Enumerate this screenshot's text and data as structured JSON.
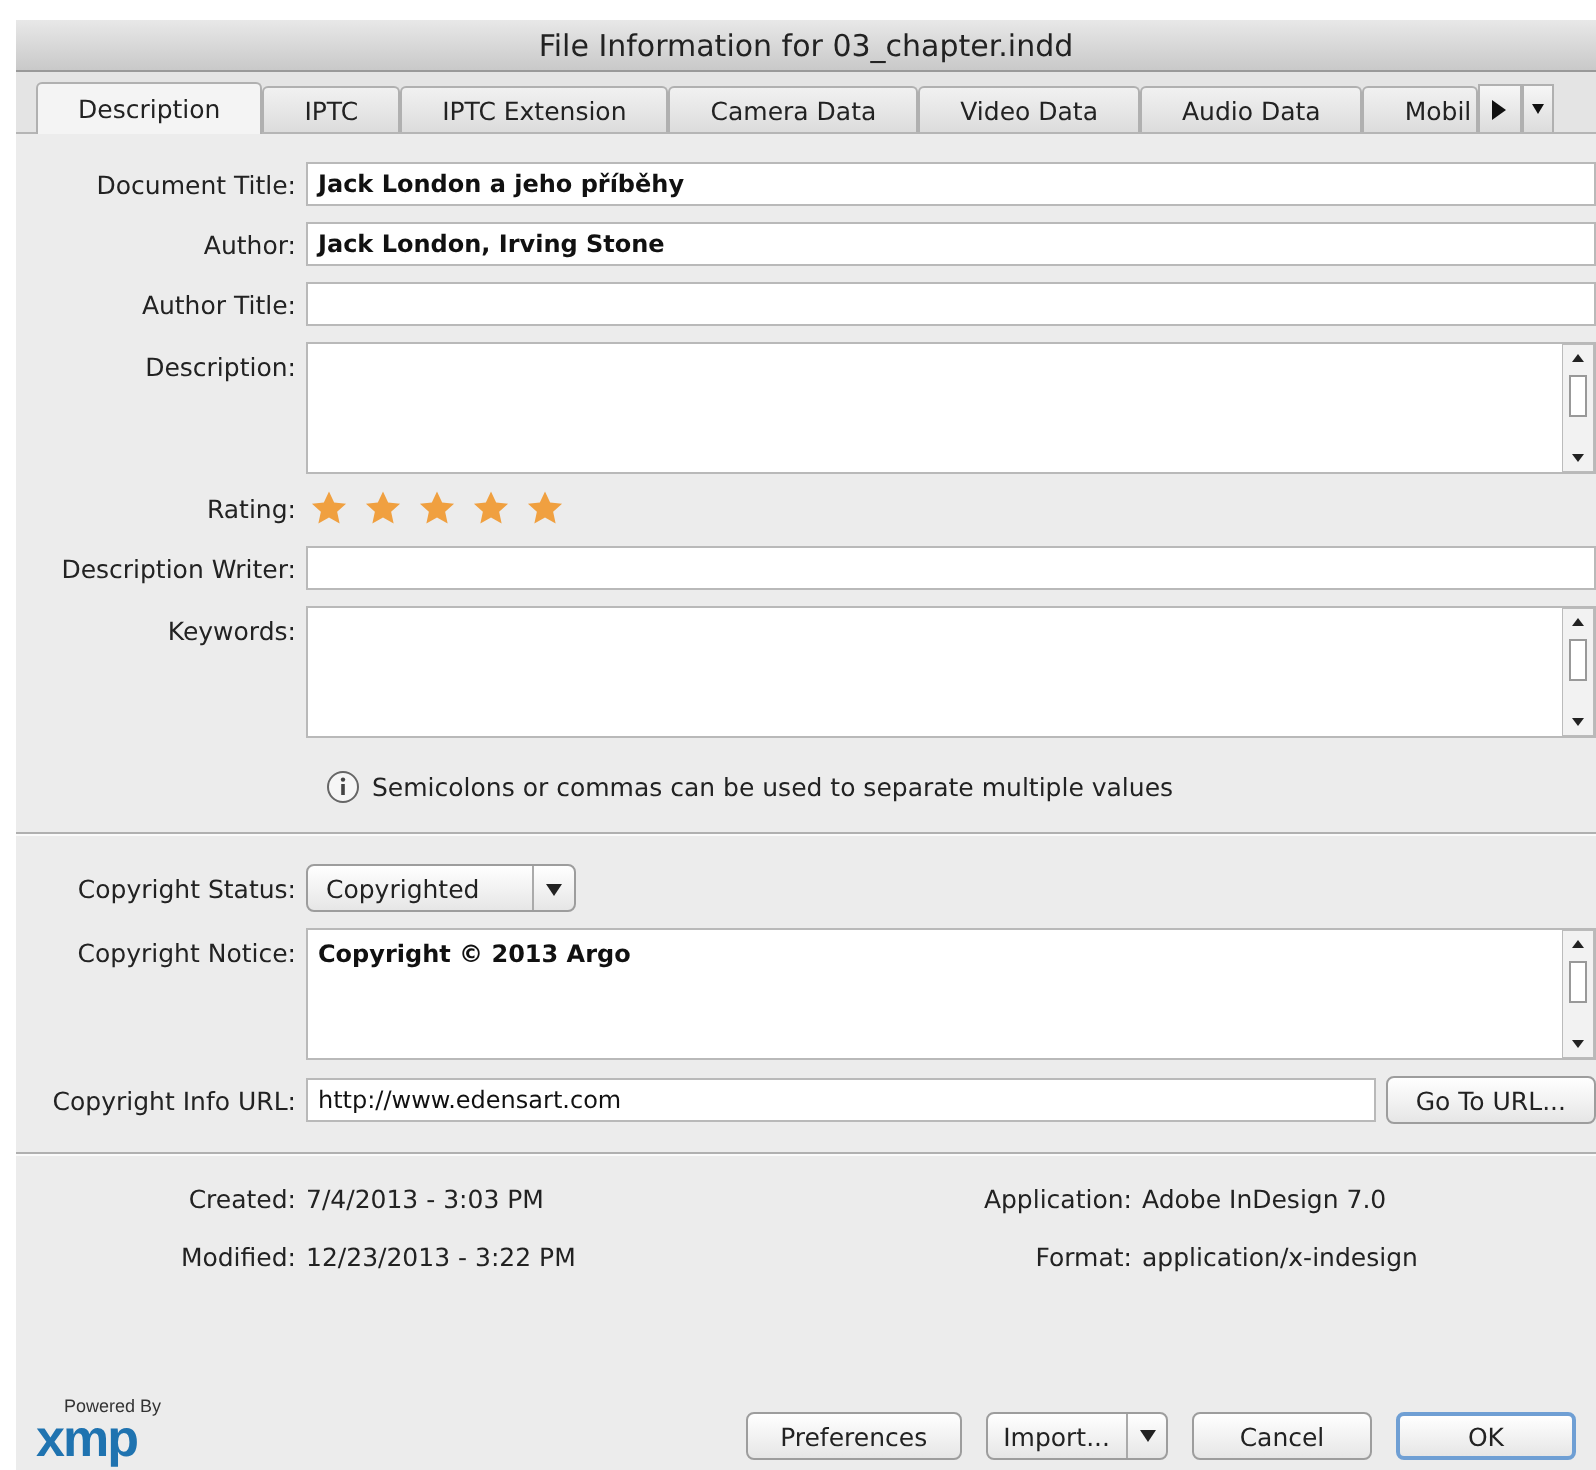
{
  "window": {
    "title": "File Information for 03_chapter.indd"
  },
  "tabs": [
    {
      "label": "Description",
      "selected": true
    },
    {
      "label": "IPTC",
      "selected": false
    },
    {
      "label": "IPTC Extension",
      "selected": false
    },
    {
      "label": "Camera Data",
      "selected": false
    },
    {
      "label": "Video Data",
      "selected": false
    },
    {
      "label": "Audio Data",
      "selected": false
    },
    {
      "label": "Mobil",
      "selected": false
    }
  ],
  "fields": [
    {
      "kind": "text",
      "label": "Document Title:",
      "value": "Jack London a jeho příběhy"
    },
    {
      "kind": "text",
      "label": "Author:",
      "value": "Jack London, Irving Stone"
    },
    {
      "kind": "text",
      "label": "Author Title:"
    },
    {
      "kind": "textarea",
      "label": "Description:"
    },
    {
      "kind": "rating",
      "label": "Rating:",
      "stars": 5
    },
    {
      "kind": "text",
      "label": "Description Writer:"
    },
    {
      "kind": "textarea",
      "label": "Keywords:",
      "hint": "Semicolons or commas can be used to separate multiple values"
    }
  ],
  "copyright": [
    {
      "kind": "select",
      "label": "Copyright Status:",
      "value": "Copyrighted"
    },
    {
      "kind": "textarea",
      "label": "Copyright Notice:",
      "value": "Copyright © 2013 Argo"
    },
    {
      "kind": "url",
      "label": "Copyright Info URL:",
      "value": "http://www.edensart.com",
      "button": "Go To URL..."
    }
  ],
  "info": [
    {
      "label": "Created:",
      "value": "7/4/2013 - 3:03 PM"
    },
    {
      "label": "Application:",
      "value": "Adobe InDesign 7.0"
    },
    {
      "label": "Modified:",
      "value": "12/23/2013 - 3:22 PM"
    },
    {
      "label": "Format:",
      "value": "application/x-indesign"
    }
  ],
  "footer": {
    "powered_by": "Powered By",
    "logo": "xmp",
    "buttons": [
      {
        "kind": "plain",
        "label": "Preferences"
      },
      {
        "kind": "split",
        "label": "Import..."
      },
      {
        "kind": "plain",
        "label": "Cancel"
      },
      {
        "kind": "default",
        "label": "OK"
      }
    ]
  }
}
